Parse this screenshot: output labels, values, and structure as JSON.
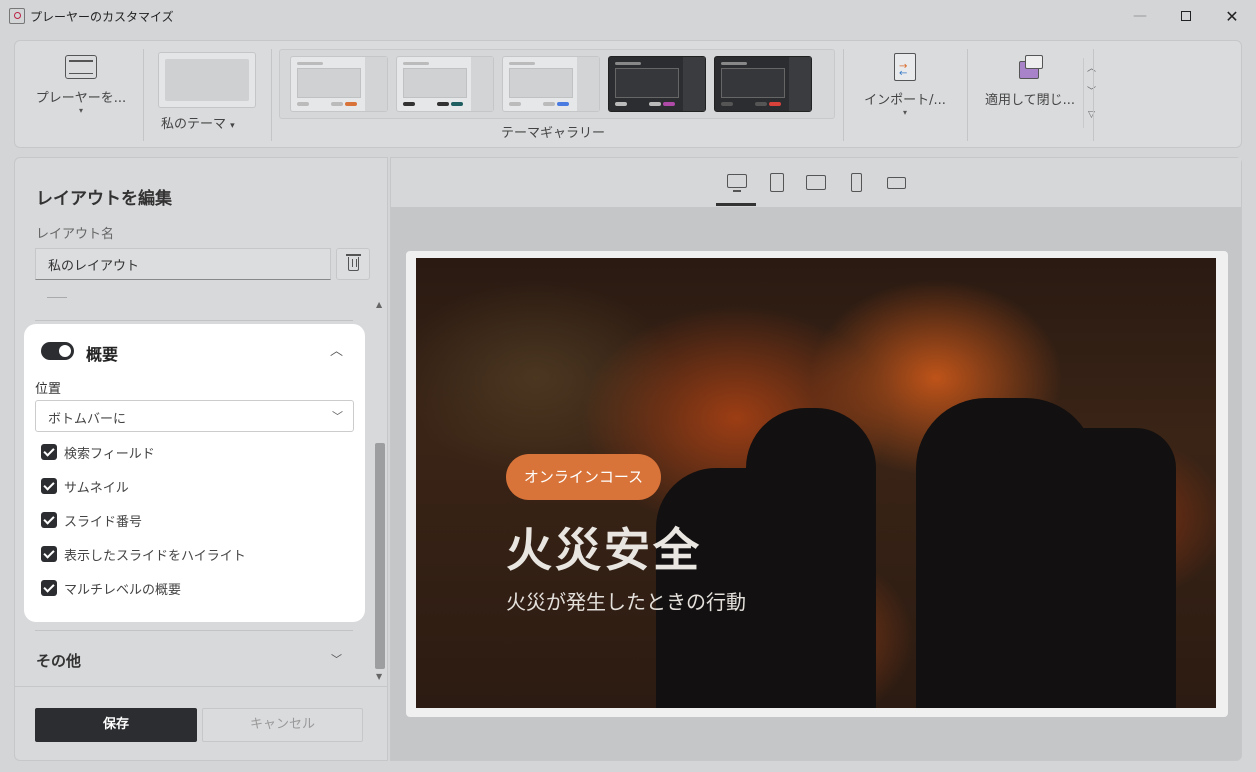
{
  "window": {
    "title": "プレーヤーのカスタマイズ",
    "minimize": "—",
    "close": "✕"
  },
  "ribbon": {
    "player_label": "プレーヤーを...",
    "mytheme_label": "私のテーマ",
    "gallery_label": "テーマギャラリー",
    "import_label": "インポート/...",
    "apply_label": "適用して閉じ...",
    "caret": "▾",
    "gallery_scroll": {
      "up": "︿",
      "down": "﹀",
      "more": "▽"
    },
    "themes": [
      {
        "style": "light",
        "pills": [
          "#bbbbbb",
          "#bbbbbb",
          "#d8743a"
        ]
      },
      {
        "style": "light",
        "pills": [
          "#333333",
          "#333333",
          "#1f5f62"
        ]
      },
      {
        "style": "light",
        "pills": [
          "#bbbbbb",
          "#bbbbbb",
          "#4a7be0"
        ]
      },
      {
        "style": "dark",
        "pills": [
          "#bbbbbb",
          "#bbbbbb",
          "#b04aa8"
        ]
      },
      {
        "style": "dark",
        "pills": [
          "#555555",
          "#555555",
          "#d9423a"
        ]
      }
    ]
  },
  "left_panel": {
    "title": "レイアウトを編集",
    "layout_name_label": "レイアウト名",
    "layout_name_value": "私のレイアウト",
    "summary": {
      "title": "概要",
      "enabled": true,
      "chevron": "︿",
      "position_label": "位置",
      "position_value": "ボトムバーに",
      "position_chevron": "﹀",
      "options": [
        {
          "label": "検索フィールド",
          "checked": true
        },
        {
          "label": "サムネイル",
          "checked": true
        },
        {
          "label": "スライド番号",
          "checked": true
        },
        {
          "label": "表示したスライドをハイライト",
          "checked": true
        },
        {
          "label": "マルチレベルの概要",
          "checked": true
        }
      ]
    },
    "other": {
      "title": "その他",
      "chevron": "﹀"
    },
    "save_label": "保存",
    "cancel_label": "キャンセル",
    "scroll_up": "▲",
    "scroll_down": "▼"
  },
  "preview": {
    "pill": "オンラインコース",
    "title": "火災安全",
    "subtitle": "火災が発生したときの行動"
  },
  "colors": {
    "accent": "#d8743a",
    "dark": "#2b2d30"
  }
}
